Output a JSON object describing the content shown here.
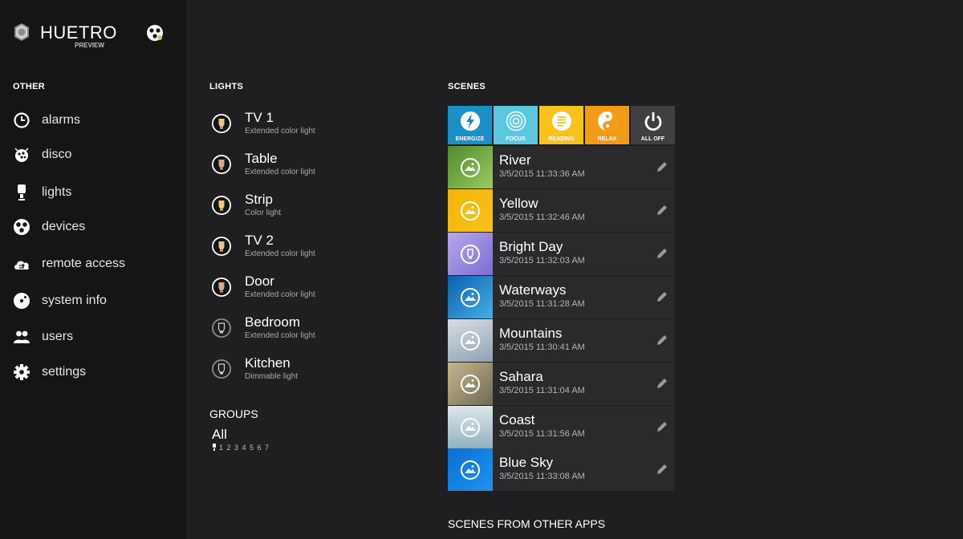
{
  "app": {
    "title": "HUETRO",
    "subtitle": "PREVIEW"
  },
  "sidebar": {
    "header": "OTHER",
    "items": [
      {
        "label": "alarms",
        "icon": "clock-icon"
      },
      {
        "label": "disco",
        "icon": "disco-ball-icon"
      },
      {
        "label": "lights",
        "icon": "lamp-icon"
      },
      {
        "label": "devices",
        "icon": "devices-icon"
      },
      {
        "label": "remote access",
        "icon": "cloud-sync-icon"
      },
      {
        "label": "system info",
        "icon": "info-disc-icon"
      },
      {
        "label": "users",
        "icon": "users-icon"
      },
      {
        "label": "settings",
        "icon": "gear-icon"
      }
    ]
  },
  "lights": {
    "header": "LIGHTS",
    "items": [
      {
        "name": "TV 1",
        "type": "Extended color light",
        "on": true
      },
      {
        "name": "Table",
        "type": "Extended color light",
        "on": true
      },
      {
        "name": "Strip",
        "type": "Color light",
        "on": true
      },
      {
        "name": "TV 2",
        "type": "Extended color light",
        "on": true
      },
      {
        "name": "Door",
        "type": "Extended color light",
        "on": true
      },
      {
        "name": "Bedroom",
        "type": "Extended color light",
        "on": false
      },
      {
        "name": "Kitchen",
        "type": "Dimmable light",
        "on": false
      }
    ]
  },
  "groups": {
    "header": "GROUPS",
    "items": [
      {
        "name": "All",
        "members": "1 2 3 4 5 6 7"
      }
    ]
  },
  "scenes": {
    "header": "SCENES",
    "quick": [
      {
        "label": "ENERGIZE",
        "color": "#1a8fc8",
        "icon": "energize-icon"
      },
      {
        "label": "FOCUS",
        "color": "#5cc8e0",
        "icon": "focus-icon"
      },
      {
        "label": "READING",
        "color": "#f8c21a",
        "icon": "reading-icon"
      },
      {
        "label": "RELAX",
        "color": "#f39a16",
        "icon": "relax-icon"
      },
      {
        "label": "ALL OFF",
        "color": "#404042",
        "icon": "power-icon"
      }
    ],
    "items": [
      {
        "name": "River",
        "time": "3/5/2015 11:33:36 AM",
        "colors": [
          "#4d8a2e",
          "#9ccc5e"
        ]
      },
      {
        "name": "Yellow",
        "time": "3/5/2015 11:32:46 AM",
        "colors": [
          "#f4b40a",
          "#f8c21a"
        ]
      },
      {
        "name": "Bright Day",
        "time": "3/5/2015 11:32:03 AM",
        "colors": [
          "#b7a8ea",
          "#7d6cd4"
        ]
      },
      {
        "name": "Waterways",
        "time": "3/5/2015 11:31:28 AM",
        "colors": [
          "#0a5fae",
          "#46b0e6"
        ]
      },
      {
        "name": "Mountains",
        "time": "3/5/2015 11:30:41 AM",
        "colors": [
          "#8fa3b4",
          "#d8dde2"
        ]
      },
      {
        "name": "Sahara",
        "time": "3/5/2015 11:31:04 AM",
        "colors": [
          "#6f6a55",
          "#c6b68e"
        ]
      },
      {
        "name": "Coast",
        "time": "3/5/2015 11:31:56 AM",
        "colors": [
          "#dfe7ea",
          "#8fb2c0"
        ]
      },
      {
        "name": "Blue Sky",
        "time": "3/5/2015 11:33:08 AM",
        "colors": [
          "#0b6fd6",
          "#1f93ee"
        ]
      }
    ],
    "other_header": "SCENES FROM OTHER APPS"
  }
}
